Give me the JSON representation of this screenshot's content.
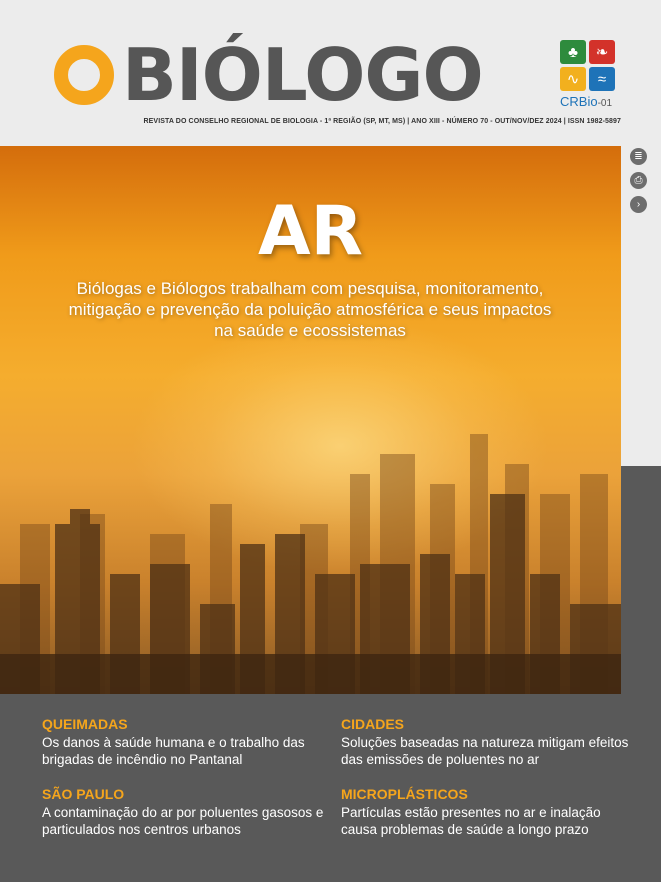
{
  "header": {
    "logo_o": "O",
    "logo_word": "BIÓLOGO",
    "tagline": "REVISTA DO CONSELHO REGIONAL DE BIOLOGIA - 1ª REGIÃO (SP, MT, MS) | ANO XIII - NÚMERO 70 - OUT/NOV/DEZ 2024 | ISSN 1982-5897",
    "crbio_label": "CRBio",
    "crbio_suffix": "-01",
    "crbio_tiles": [
      {
        "icon": "tree-icon",
        "glyph": "♣",
        "color": "#2e8b3d"
      },
      {
        "icon": "bird-icon",
        "glyph": "❧",
        "color": "#d3322a"
      },
      {
        "icon": "lizard-icon",
        "glyph": "∿",
        "color": "#f2b01e"
      },
      {
        "icon": "fish-icon",
        "glyph": "≈",
        "color": "#1e73b8"
      }
    ]
  },
  "hero": {
    "title": "AR",
    "subtitle": "Biólogas e Biólogos trabalham com pesquisa, monitoramento, mitigação e prevenção da poluição atmosférica e seus impactos na saúde e ecossistemas"
  },
  "side_controls": [
    {
      "icon": "list-icon",
      "glyph": "≣"
    },
    {
      "icon": "print-icon",
      "glyph": "⎙"
    },
    {
      "icon": "chevron-right-icon",
      "glyph": "›"
    }
  ],
  "stories": [
    {
      "kicker": "QUEIMADAS",
      "text": "Os danos à saúde humana e o trabalho das brigadas de incêndio no Pantanal"
    },
    {
      "kicker": "CIDADES",
      "text": "Soluções baseadas na natureza mitigam efeitos das emissões de poluentes no ar"
    },
    {
      "kicker": "SÃO PAULO",
      "text": "A contaminação do ar por poluentes gasosos e particulados nos centros urbanos"
    },
    {
      "kicker": "MICROPLÁSTICOS",
      "text": "Partículas estão presentes no ar e inalação causa problemas de saúde a longo prazo"
    }
  ],
  "colors": {
    "accent": "#f5a51c",
    "logo_gray": "#565656",
    "bottom_bg": "#595959"
  }
}
